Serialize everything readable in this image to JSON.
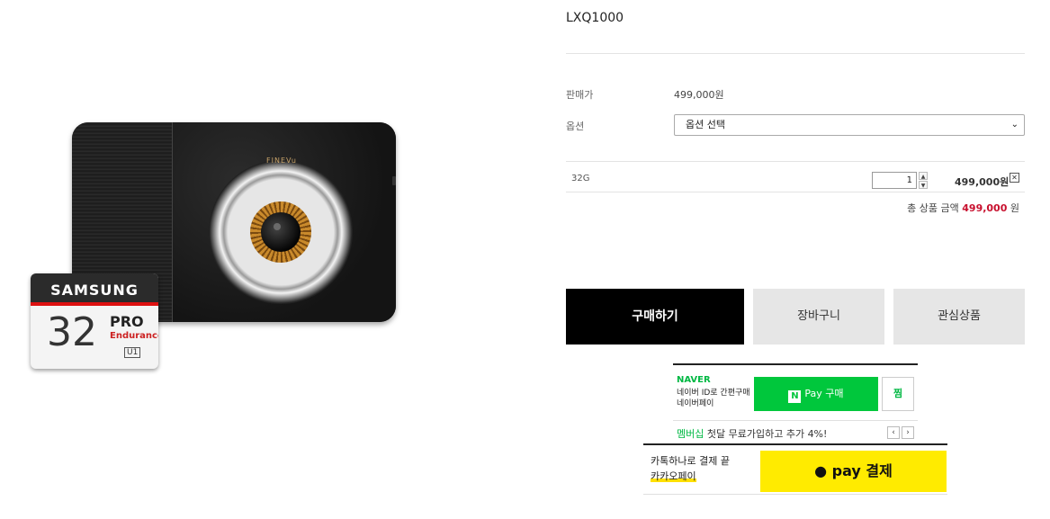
{
  "product": {
    "name": "LXQ1000",
    "price_label": "판매가",
    "price_value": "499,000원",
    "option_label": "옵션",
    "option_selected": "옵션 선택"
  },
  "product_image": {
    "camera_brand": "FINEVu",
    "sdcard_brand": "SAMSUNG",
    "sdcard_capacity": "32",
    "sdcard_line": "PRO",
    "sdcard_edition": "Endurance"
  },
  "selected_item": {
    "option": "32G",
    "quantity": "1",
    "price": "499,000원",
    "remove_icon": "close-icon"
  },
  "total": {
    "label": "총 상품 금액",
    "amount": "499,000",
    "unit": "원"
  },
  "actions": {
    "buy": "구매하기",
    "cart": "장바구니",
    "wishlist": "관심상품"
  },
  "naver_pay": {
    "logo": "NAVER",
    "subtitle": "네이버 ID로 간편구매 네이버페이",
    "button": "Pay 구매",
    "button_badge": "N",
    "wish": "찜",
    "promo_highlight": "멤버십",
    "promo_text": "첫달 무료가입하고 추가 4%!",
    "prev_icon": "chevron-left-icon",
    "next_icon": "chevron-right-icon"
  },
  "kakao_pay": {
    "line1": "카톡하나로 결제 끝",
    "line2": "카카오페이",
    "button": "pay 결제",
    "icon": "speech-bubble-icon"
  },
  "colors": {
    "price_accent": "#c8102e",
    "naver_green": "#00c73c",
    "kakao_yellow": "#ffeb00",
    "buy_button": "#000000"
  }
}
